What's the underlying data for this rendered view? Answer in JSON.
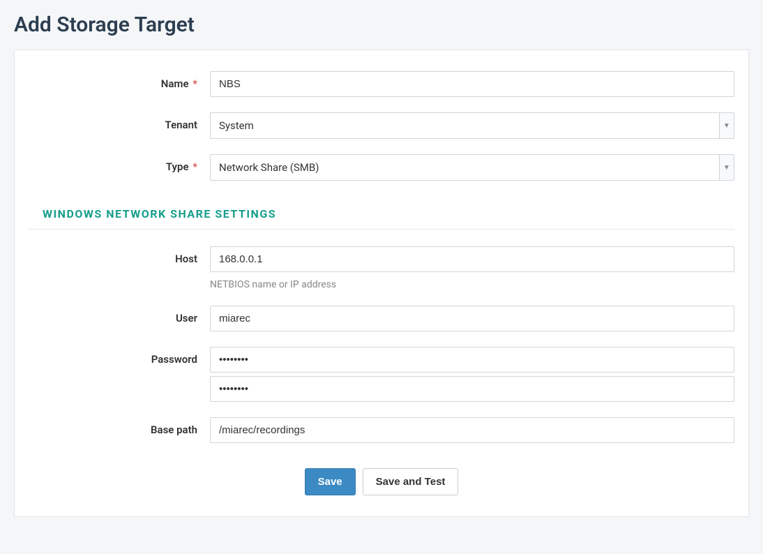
{
  "page": {
    "title": "Add Storage Target"
  },
  "form": {
    "name": {
      "label": "Name",
      "required": true,
      "value": "NBS"
    },
    "tenant": {
      "label": "Tenant",
      "required": false,
      "value": "System"
    },
    "type": {
      "label": "Type",
      "required": true,
      "value": "Network Share (SMB)"
    },
    "section_header": "WINDOWS NETWORK SHARE SETTINGS",
    "host": {
      "label": "Host",
      "value": "168.0.0.1",
      "help": "NETBIOS name or IP address"
    },
    "user": {
      "label": "User",
      "value": "miarec"
    },
    "password": {
      "label": "Password",
      "value": "••••••••",
      "confirm_value": "••••••••"
    },
    "base_path": {
      "label": "Base path",
      "value": "/miarec/recordings"
    }
  },
  "buttons": {
    "save": "Save",
    "save_test": "Save and Test"
  },
  "required_marker": "*"
}
